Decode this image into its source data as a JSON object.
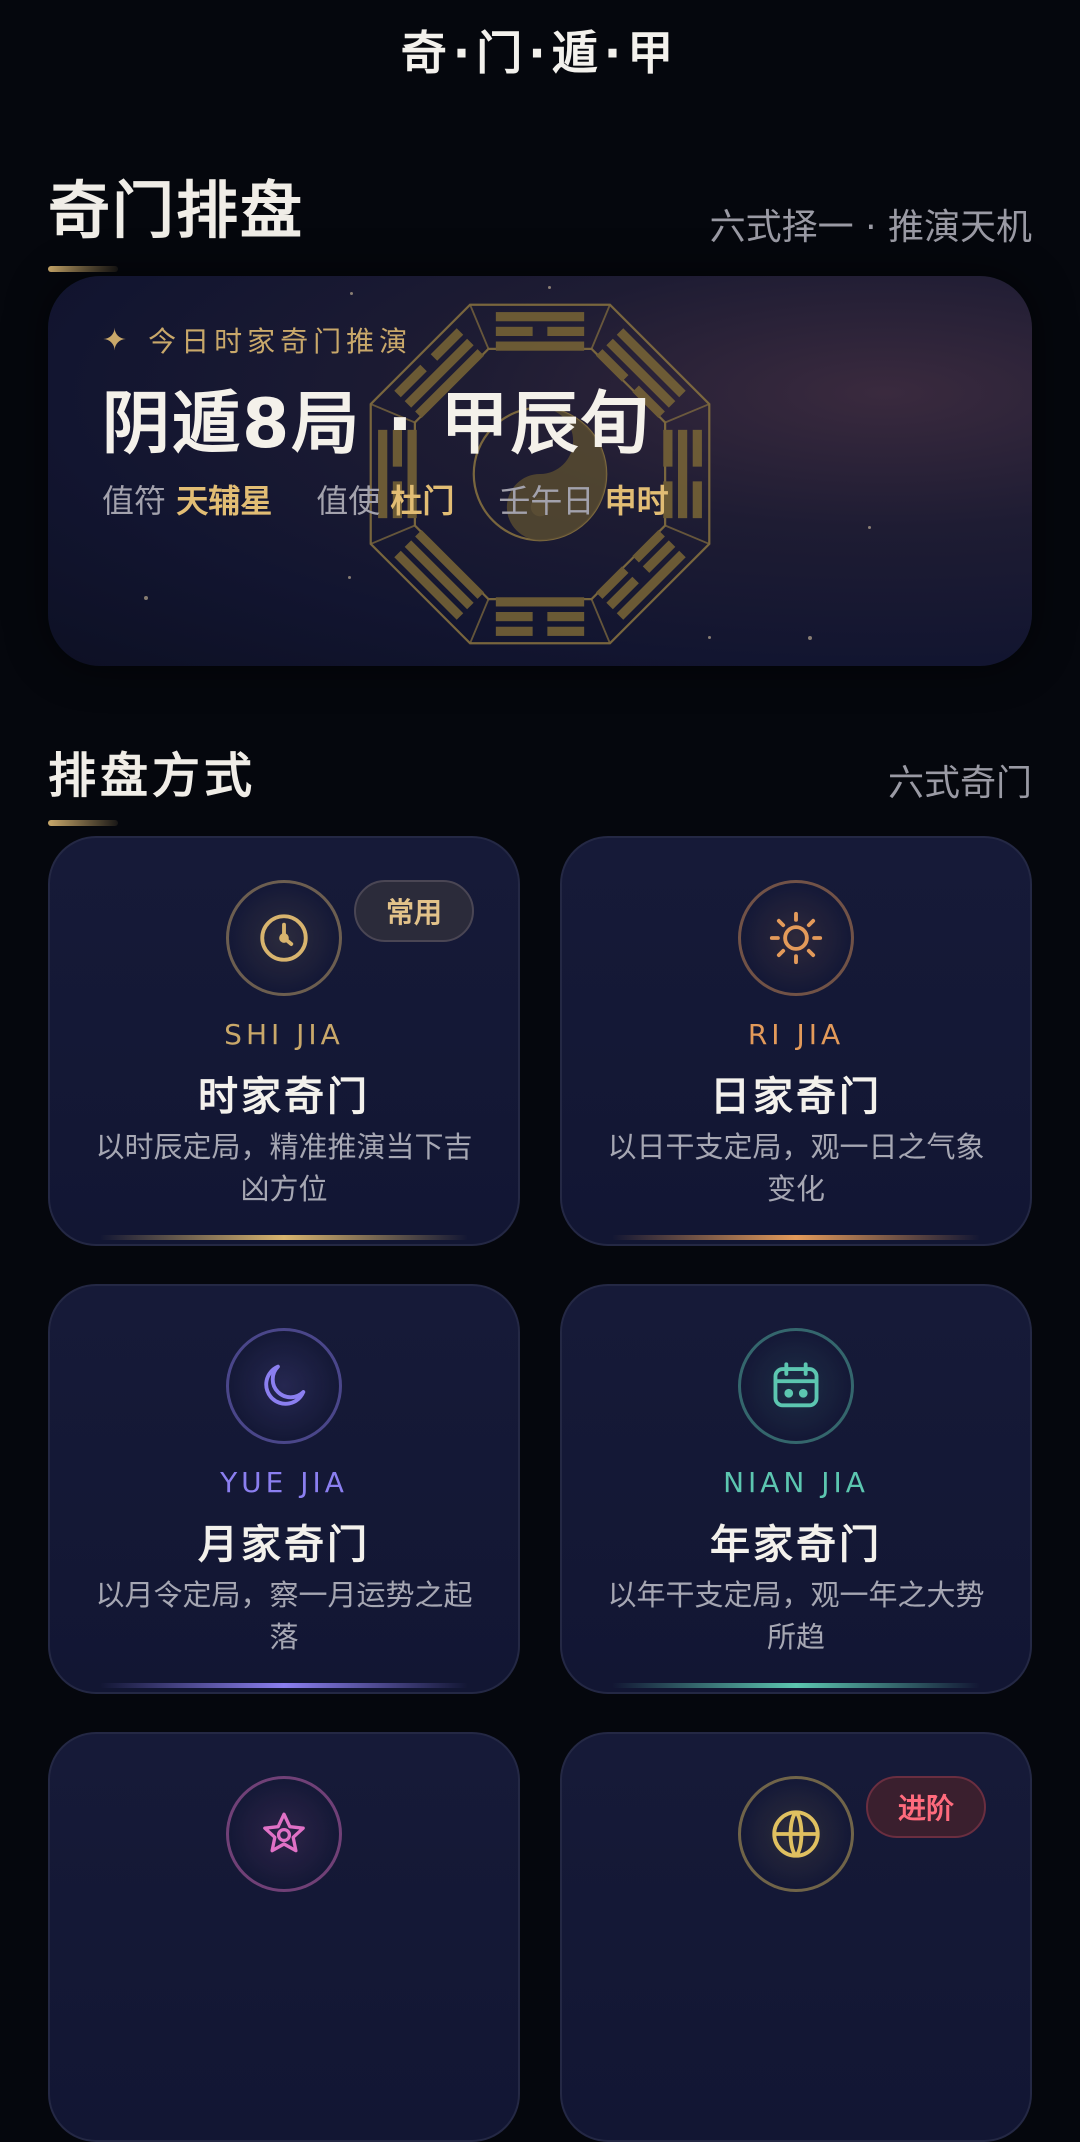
{
  "app": {
    "title": "奇·门·遁·甲"
  },
  "header": {
    "title": "奇门排盘",
    "subtitle": "六式择一 · 推演天机"
  },
  "hero": {
    "tag": "今日时家奇门推演",
    "title": "阴遁8局 · 甲辰旬",
    "info": [
      {
        "label": "值符",
        "value": "天辅星"
      },
      {
        "label": "值使",
        "value": "杜门"
      },
      {
        "label": "壬午日",
        "value": "申时"
      }
    ]
  },
  "methods": {
    "title": "排盘方式",
    "subtitle": "六式奇门",
    "cards": [
      {
        "pinyin": "SHI JIA",
        "name": "时家奇门",
        "desc": "以时辰定局，精准推演当下吉凶方位",
        "badge": "常用",
        "icon": "clock-icon",
        "color": "#d8b46e"
      },
      {
        "pinyin": "RI JIA",
        "name": "日家奇门",
        "desc": "以日干支定局，观一日之气象变化",
        "icon": "sun-icon",
        "color": "#e39a5a"
      },
      {
        "pinyin": "YUE JIA",
        "name": "月家奇门",
        "desc": "以月令定局，察一月运势之起落",
        "icon": "moon-icon",
        "color": "#8b7ff0"
      },
      {
        "pinyin": "NIAN JIA",
        "name": "年家奇门",
        "desc": "以年干支定局，观一年之大势所趋",
        "icon": "calendar-icon",
        "color": "#5cc6b0"
      },
      {
        "icon": "star-icon",
        "color": "#e071c6"
      },
      {
        "badge": "进阶",
        "icon": "globe-icon",
        "color": "#e0c060"
      }
    ]
  }
}
